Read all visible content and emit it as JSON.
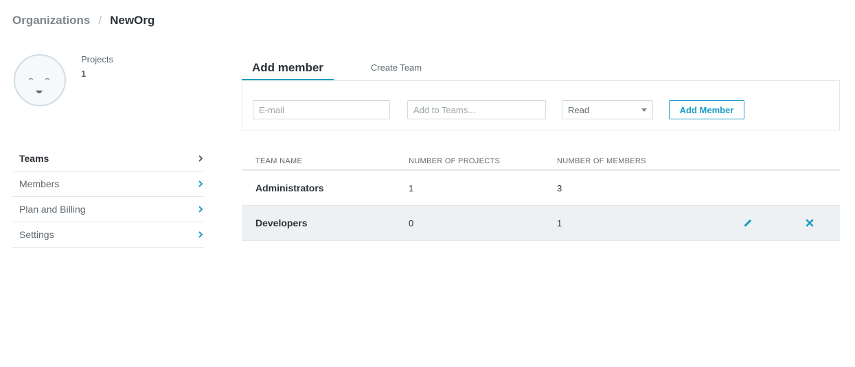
{
  "breadcrumb": {
    "parent": "Organizations",
    "separator": "/",
    "current": "NewOrg"
  },
  "org": {
    "avatar_icon": "smiley-face-avatar",
    "stats_label": "Projects",
    "stats_value": "1"
  },
  "sidebar": {
    "items": [
      {
        "label": "Teams",
        "active": true
      },
      {
        "label": "Members",
        "active": false
      },
      {
        "label": "Plan and Billing",
        "active": false
      },
      {
        "label": "Settings",
        "active": false
      }
    ]
  },
  "tabs": {
    "active": "Add member",
    "inactive": "Create Team"
  },
  "add_member_form": {
    "email_placeholder": "E-mail",
    "teams_placeholder": "Add to Teams...",
    "permission_value": "Read",
    "submit_label": "Add Member"
  },
  "table": {
    "headers": [
      "TEAM NAME",
      "NUMBER OF PROJECTS",
      "NUMBER OF MEMBERS"
    ],
    "rows": [
      {
        "name": "Administrators",
        "projects": "1",
        "members": "3"
      },
      {
        "name": "Developers",
        "projects": "0",
        "members": "1"
      }
    ]
  },
  "colors": {
    "accent": "#1c9dc6",
    "text": "#2b3136",
    "muted": "#7d868c",
    "border": "#e3e7ea",
    "row_highlight": "#eef1f3"
  },
  "icons": {
    "chevron": "chevron-right-icon",
    "edit": "pencil-icon",
    "delete": "close-icon"
  }
}
